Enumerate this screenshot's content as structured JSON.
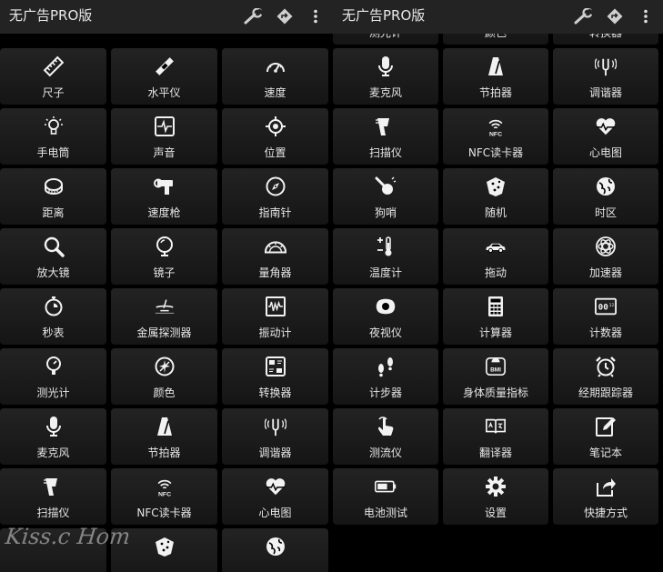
{
  "left": {
    "title": "无广告PRO版",
    "rows": [
      [
        "尺子",
        "水平仪",
        "速度"
      ],
      [
        "手电筒",
        "声音",
        "位置"
      ],
      [
        "距离",
        "速度枪",
        "指南针"
      ],
      [
        "放大镜",
        "镜子",
        "量角器"
      ],
      [
        "秒表",
        "金属探测器",
        "振动计"
      ],
      [
        "测光计",
        "颜色",
        "转换器"
      ],
      [
        "麦克风",
        "节拍器",
        "调谐器"
      ],
      [
        "扫描仪",
        "NFC读卡器",
        "心电图"
      ],
      [
        "",
        "",
        ""
      ]
    ],
    "icons": [
      [
        "ruler-icon",
        "level-icon",
        "speedometer-icon"
      ],
      [
        "flashlight-icon",
        "sound-icon",
        "location-icon"
      ],
      [
        "tape-measure-icon",
        "speed-gun-icon",
        "compass-icon"
      ],
      [
        "magnifier-icon",
        "mirror-icon",
        "protractor-icon"
      ],
      [
        "stopwatch-icon",
        "metal-detector-icon",
        "vibration-icon"
      ],
      [
        "light-meter-icon",
        "color-icon",
        "converter-icon"
      ],
      [
        "microphone-icon",
        "metronome-icon",
        "tuner-icon"
      ],
      [
        "scanner-icon",
        "nfc-icon",
        "heart-rate-icon"
      ],
      [
        "",
        "dice-icon",
        "globe-icon"
      ]
    ],
    "watermark": "Kiss.c Hom"
  },
  "right": {
    "title": "无广告PRO版",
    "rows": [
      [
        "测光计",
        "颜色",
        "转换器"
      ],
      [
        "麦克风",
        "节拍器",
        "调谐器"
      ],
      [
        "扫描仪",
        "NFC读卡器",
        "心电图"
      ],
      [
        "狗哨",
        "随机",
        "时区"
      ],
      [
        "温度计",
        "拖动",
        "加速器"
      ],
      [
        "夜视仪",
        "计算器",
        "计数器"
      ],
      [
        "计步器",
        "身体质量指标",
        "经期跟踪器"
      ],
      [
        "测流仪",
        "翻译器",
        "笔记本"
      ],
      [
        "电池测试",
        "设置",
        "快捷方式"
      ]
    ],
    "icons": [
      [
        "light-meter-icon",
        "color-icon",
        "converter-icon"
      ],
      [
        "microphone-icon",
        "metronome-icon",
        "tuner-icon"
      ],
      [
        "scanner-icon",
        "nfc-icon",
        "heart-rate-icon"
      ],
      [
        "dog-whistle-icon",
        "dice-icon",
        "globe-icon"
      ],
      [
        "thermometer-icon",
        "car-icon",
        "atom-icon"
      ],
      [
        "night-vision-icon",
        "calculator-icon",
        "counter-icon"
      ],
      [
        "footsteps-icon",
        "bmi-icon",
        "alarm-clock-icon"
      ],
      [
        "touch-hand-icon",
        "translate-book-icon",
        "notepad-icon"
      ],
      [
        "battery-icon",
        "gear-icon",
        "share-icon"
      ]
    ]
  },
  "icon_glyphs": {
    "nfc_text": "NFC",
    "bmi_text": "BMI",
    "counter_text": "00",
    "counter_small": "12"
  },
  "colors": {
    "topbar": "#232323",
    "tile": "#1c1c1c",
    "text": "#e6e6e6",
    "background": "#000000"
  }
}
